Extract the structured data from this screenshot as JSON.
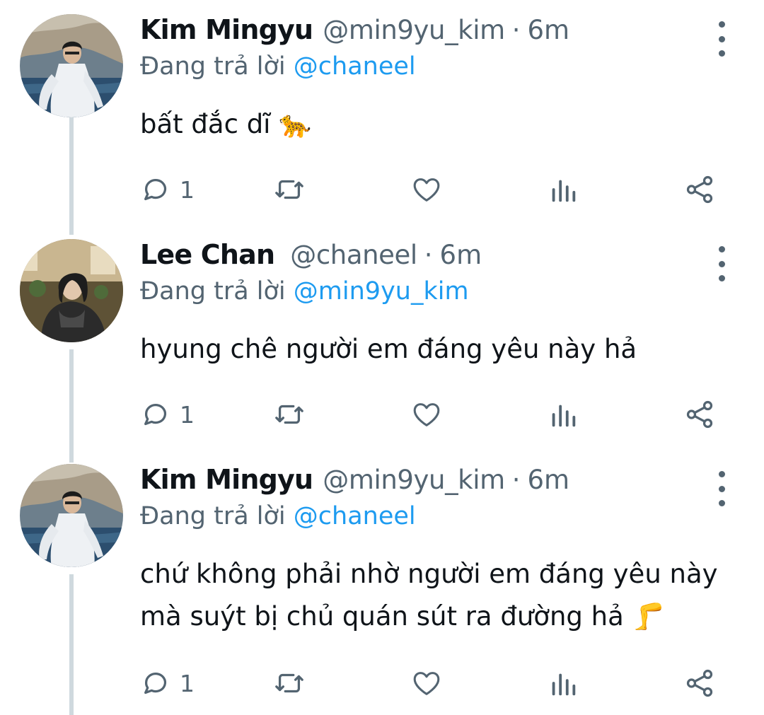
{
  "tweets": [
    {
      "name": "Kim Mingyu",
      "handle": "@min9yu_kim",
      "separator": "·",
      "time": "6m",
      "replying_prefix": "Đang trả lời",
      "replying_to": "@chaneel",
      "text_lines": [
        "bất đắc dĩ 🐆"
      ],
      "reply_count": "1",
      "avatar": "mingyu-avatar"
    },
    {
      "name": "Lee Chan",
      "handle": "@chaneel",
      "separator": "·",
      "time": "6m",
      "replying_prefix": "Đang trả lời",
      "replying_to": "@min9yu_kim",
      "text_lines": [
        "hyung chê người em đáng yêu này hả"
      ],
      "reply_count": "1",
      "avatar": "chan-avatar"
    },
    {
      "name": "Kim Mingyu",
      "handle": "@min9yu_kim",
      "separator": "·",
      "time": "6m",
      "replying_prefix": "Đang trả lời",
      "replying_to": "@chaneel",
      "text_lines": [
        "chứ không phải nhờ người em đáng yêu này",
        "mà suýt bị chủ quán sút ra đường hả 🦵"
      ],
      "reply_count": "1",
      "avatar": "mingyu-avatar"
    }
  ],
  "icons": {
    "reply": "reply-icon",
    "retweet": "retweet-icon",
    "like": "heart-icon",
    "views": "analytics-icon",
    "share": "share-icon",
    "more": "more-options-icon"
  },
  "colors": {
    "text": "#0f1419",
    "secondary": "#536471",
    "mention": "#1d9bf0",
    "thread_line": "#cfd9de"
  }
}
